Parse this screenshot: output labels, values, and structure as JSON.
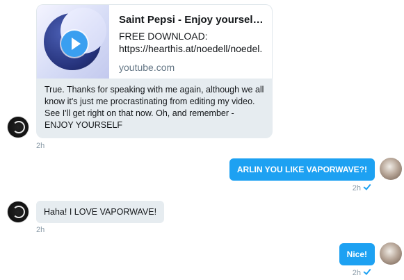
{
  "link_card": {
    "title": "Saint Pepsi - Enjoy yourself ...",
    "description": "FREE DOWNLOAD:\nhttps://hearthis.at/noedell/noedel.",
    "domain": "youtube.com",
    "thumbnail_icon": "play-icon"
  },
  "messages": [
    {
      "direction": "incoming",
      "text": "True. Thanks for speaking with me again, although we all know it's just me procrastinating from editing my video. See I'll get right on that now. Oh, and remember - ENJOY YOURSELF",
      "time": "2h"
    },
    {
      "direction": "outgoing",
      "text": "ARLIN YOU LIKE VAPORWAVE?!",
      "time": "2h"
    },
    {
      "direction": "incoming",
      "text": "Haha! I LOVE VAPORWAVE!",
      "time": "2h"
    },
    {
      "direction": "outgoing",
      "text": "Nice!",
      "time": "2h"
    }
  ],
  "colors": {
    "outgoing_bubble": "#1da1f2",
    "incoming_bubble": "#e6ecf0",
    "timestamp": "#8899a6",
    "read_check": "#1da1f2"
  }
}
